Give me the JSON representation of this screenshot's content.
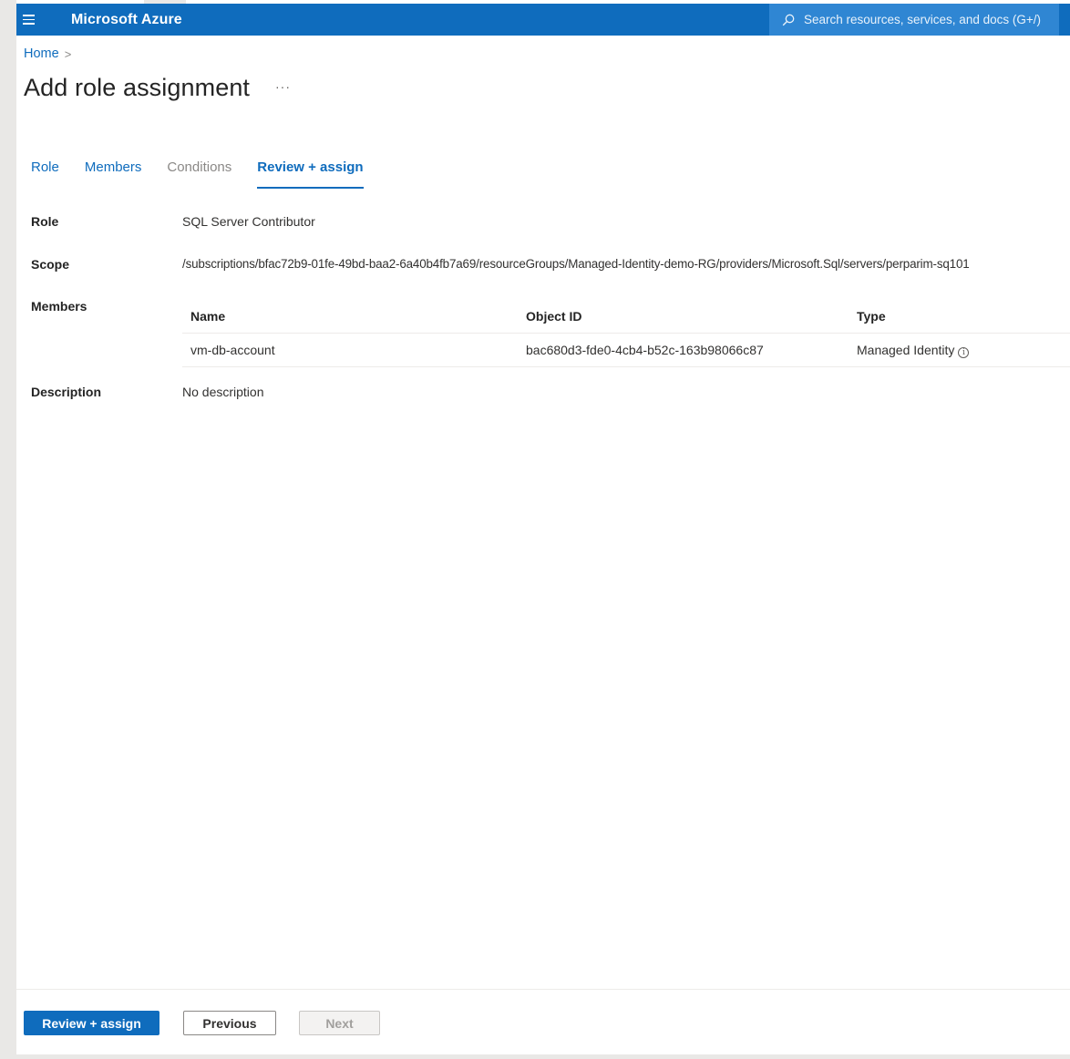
{
  "topbar": {
    "brand": "Microsoft Azure",
    "search_placeholder": "Search resources, services, and docs (G+/)"
  },
  "breadcrumb": {
    "home": "Home",
    "separator": ">"
  },
  "page": {
    "title": "Add role assignment",
    "more": "···"
  },
  "tabs": [
    {
      "label": "Role",
      "state": "enabled"
    },
    {
      "label": "Members",
      "state": "enabled"
    },
    {
      "label": "Conditions",
      "state": "disabled"
    },
    {
      "label": "Review + assign",
      "state": "active"
    }
  ],
  "review": {
    "role_label": "Role",
    "role_value": "SQL Server Contributor",
    "scope_label": "Scope",
    "scope_value": "/subscriptions/bfac72b9-01fe-49bd-baa2-6a40b4fb7a69/resourceGroups/Managed-Identity-demo-RG/providers/Microsoft.Sql/servers/perparim-sq101",
    "members_label": "Members",
    "members_table": {
      "headers": {
        "name": "Name",
        "object_id": "Object ID",
        "type": "Type"
      },
      "rows": [
        {
          "name": "vm-db-account",
          "object_id": "bac680d3-fde0-4cb4-b52c-163b98066c87",
          "type": "Managed Identity"
        }
      ]
    },
    "description_label": "Description",
    "description_value": "No description"
  },
  "footer": {
    "review_assign": "Review + assign",
    "previous": "Previous",
    "next": "Next"
  },
  "colors": {
    "brand_blue": "#0f6cbd",
    "search_bg": "#2f86d3",
    "disabled_text": "#8a8886"
  },
  "icons": {
    "menu": "hamburger-icon",
    "search": "search-icon",
    "info": "info-icon",
    "chevron": "chevron-right-icon"
  }
}
